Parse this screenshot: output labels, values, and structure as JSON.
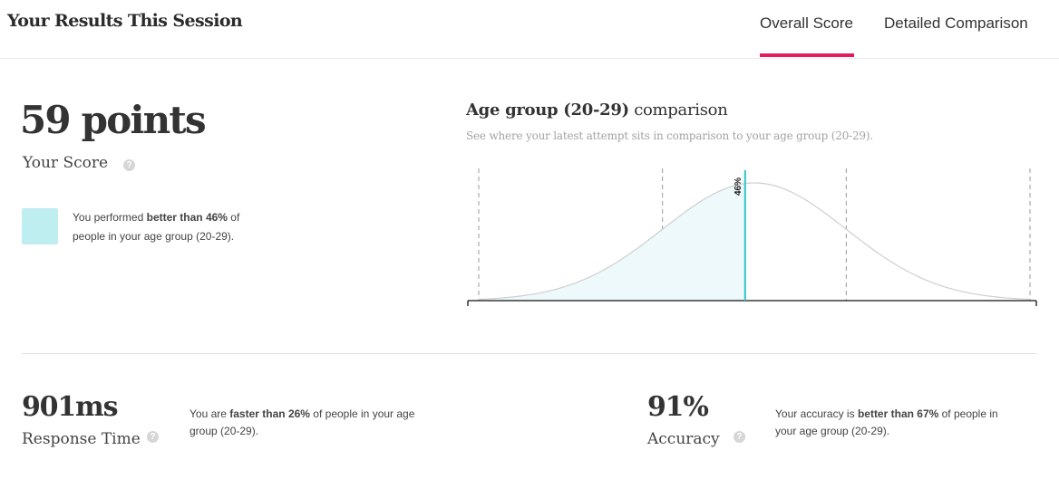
{
  "header": {
    "title": "Your Results This Session",
    "tabs": [
      {
        "label": "Overall Score",
        "active": true
      },
      {
        "label": "Detailed Comparison",
        "active": false
      }
    ],
    "accent_color": "#e6195f"
  },
  "score": {
    "value": "59 points",
    "label": "Your Score",
    "help_icon": "question-circle-icon",
    "swatch_color": "#bfeef0",
    "percentile_prefix": "You performed ",
    "percentile_bold": "better than 46%",
    "percentile_suffix": " of people in your age group (20-29)."
  },
  "chart": {
    "title_bold": "Age group (20-29)",
    "title_rest": " comparison",
    "subtitle": "See where your latest attempt sits in comparison to your age group (20-29)."
  },
  "chart_data": {
    "type": "area",
    "distribution": "normal",
    "marker_percentile": 46,
    "marker_label": "46%",
    "shaded_region": "below marker",
    "marker_color": "#3cc8c8",
    "fill_color": "#eef9fb",
    "curve_color": "#cfcfcf",
    "gridlines": "dashed vertical"
  },
  "metrics": [
    {
      "value": "901ms",
      "label": "Response Time",
      "desc_prefix": "You are ",
      "desc_bold": "faster than 26%",
      "desc_suffix": " of people in your age group (20-29)."
    },
    {
      "value": "91%",
      "label": "Accuracy",
      "desc_prefix": "Your accuracy is ",
      "desc_bold": "better than 67%",
      "desc_suffix": " of people in your age group (20-29)."
    }
  ]
}
